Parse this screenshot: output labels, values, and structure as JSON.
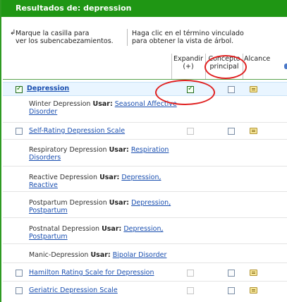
{
  "header": {
    "title": "Resultados de: depression"
  },
  "instructions": {
    "left_line1": "Marque la casilla para",
    "left_line2": "ver los subencabezamientos.",
    "right_line1": "Haga clic en el término vinculado",
    "right_line2": "para obtener la vista de árbol."
  },
  "columns": {
    "expand_line1": "Expandir",
    "expand_line2": "(+)",
    "concept_line1": "Concepto",
    "concept_line2": "principal",
    "scope": "Alcance"
  },
  "rows": [
    {
      "type": "term",
      "label": "Depression",
      "checked": true,
      "concept_checked": true,
      "highlight": true,
      "note": true
    },
    {
      "type": "usar",
      "term": "Winter Depression",
      "usar": "Usar:",
      "link": "Seasonal Affective Disorder"
    },
    {
      "type": "term",
      "label": "Self-Rating Depression Scale",
      "checked": false,
      "note": true
    },
    {
      "type": "usar",
      "term": "Respiratory Depression",
      "usar": "Usar:",
      "link": "Respiration Disorders"
    },
    {
      "type": "usar",
      "term": "Reactive Depression",
      "usar": "Usar:",
      "link": "Depression, Reactive"
    },
    {
      "type": "usar",
      "term": "Postpartum Depression",
      "usar": "Usar:",
      "link": "Depression, Postpartum"
    },
    {
      "type": "usar",
      "term": "Postnatal Depression",
      "usar": "Usar:",
      "link": "Depression, Postpartum"
    },
    {
      "type": "usar",
      "term": "Manic-Depression",
      "usar": "Usar:",
      "link": "Bipolar Disorder"
    },
    {
      "type": "term",
      "label": "Hamilton Rating Scale for Depression",
      "checked": false,
      "note": true
    },
    {
      "type": "term",
      "label": "Geriatric Depression Scale",
      "checked": false,
      "note": true
    }
  ],
  "colors": {
    "header_bg": "#1f9614",
    "link": "#1a4fb0",
    "annotation": "#e02020",
    "row_highlight": "#e9f5ff"
  },
  "icons": {
    "arrow": "return-arrow-icon",
    "note": "notepad-icon",
    "check": "checkmark-icon"
  }
}
